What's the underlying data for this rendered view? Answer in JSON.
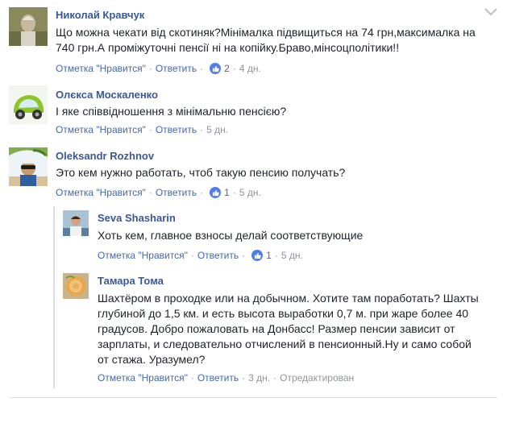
{
  "comments": [
    {
      "author": "Николай Кравчук",
      "text": "Що можна чекати від скотиняк?Мінімалка підвищиться на 74 грн,максималка на 740 грн.А проміжуточні пенсії ні на копійку.Браво,мінсоцполітики!!",
      "like_label": "Отметка \"Нравится\"",
      "reply_label": "Ответить",
      "reactions": "2",
      "time": "4 дн."
    },
    {
      "author": "Олєкса Москаленко",
      "text": "І яке співвідношення з мінімальню пенсією?",
      "like_label": "Отметка \"Нравится\"",
      "reply_label": "Ответить",
      "time": "5 дн."
    },
    {
      "author": "Oleksandr Rozhnov",
      "text": "Это кем нужно работать, чтоб такую пенсию получать?",
      "like_label": "Отметка \"Нравится\"",
      "reply_label": "Ответить",
      "reactions": "1",
      "time": "5 дн."
    }
  ],
  "replies": [
    {
      "author": "Seva Shasharin",
      "text": "Хоть кем, главное взносы делай соответствующие",
      "like_label": "Отметка \"Нравится\"",
      "reply_label": "Ответить",
      "reactions": "1",
      "time": "5 дн."
    },
    {
      "author": "Тамара Тома",
      "text": "Шахтёром в проходке или на добычном. Хотите там поработать? Шахты глубиной до 1,5 км. и есть высота выработки 0,7 м. при жаре более 40 градусов. Добро пожаловать на Донбасс! Размер пенсии зависит от зарплаты, и следовательно отчислений в пенсионный.Ну и само собой от стажа. Уразумел?",
      "like_label": "Отметка \"Нравится\"",
      "reply_label": "Ответить",
      "time": "3 дн.",
      "edited": "Отредактирован"
    }
  ],
  "colors": {
    "link": "#385898",
    "action_link": "#4267b2",
    "muted": "#90949c",
    "like_blue": "#4f7cf0"
  }
}
